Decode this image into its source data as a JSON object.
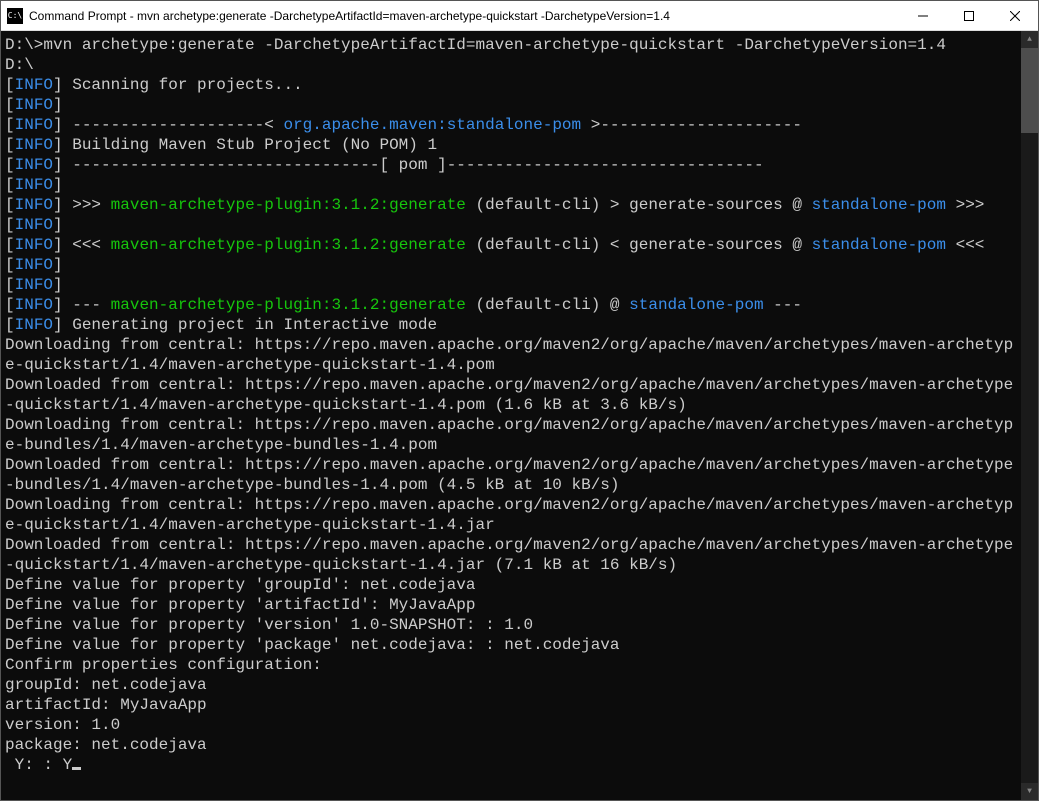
{
  "window": {
    "title": "Command Prompt - mvn  archetype:generate -DarchetypeArtifactId=maven-archetype-quickstart -DarchetypeVersion=1.4",
    "icon_label": "C:\\"
  },
  "terminal": {
    "cmd_prompt": "D:\\>",
    "cmd_line": "mvn archetype:generate -DarchetypeArtifactId=maven-archetype-quickstart -DarchetypeVersion=1.4",
    "cwd": "D:\\",
    "info_label": "INFO",
    "scan_msg": " Scanning for projects...",
    "bar_open_artifact": " --------------------< ",
    "artifact_coord": "org.apache.maven:standalone-pom",
    "bar_close_artifact": " >---------------------",
    "building_msg": " Building Maven Stub Project (No POM) 1",
    "bar_pom": " --------------------------------[ pom ]---------------------------------",
    "arrows_in": " >>> ",
    "arrows_out": " <<< ",
    "dashes3": " --- ",
    "plugin_goal": "maven-archetype-plugin:3.1.2:generate",
    "default_cli_gt": " (default-cli) > generate-sources @ ",
    "default_cli_lt": " (default-cli) < generate-sources @ ",
    "default_cli_at": " (default-cli) @ ",
    "standalone": "standalone-pom",
    "arrows_in_end": " >>>",
    "arrows_out_end": " <<<",
    "dashes3_end": " ---",
    "gen_interactive": " Generating project in Interactive mode",
    "dl_lines": [
      "Downloading from central: https://repo.maven.apache.org/maven2/org/apache/maven/archetypes/maven-archetype-quickstart/1.4/maven-archetype-quickstart-1.4.pom",
      "Downloaded from central: https://repo.maven.apache.org/maven2/org/apache/maven/archetypes/maven-archetype-quickstart/1.4/maven-archetype-quickstart-1.4.pom (1.6 kB at 3.6 kB/s)",
      "Downloading from central: https://repo.maven.apache.org/maven2/org/apache/maven/archetypes/maven-archetype-bundles/1.4/maven-archetype-bundles-1.4.pom",
      "Downloaded from central: https://repo.maven.apache.org/maven2/org/apache/maven/archetypes/maven-archetype-bundles/1.4/maven-archetype-bundles-1.4.pom (4.5 kB at 10 kB/s)",
      "Downloading from central: https://repo.maven.apache.org/maven2/org/apache/maven/archetypes/maven-archetype-quickstart/1.4/maven-archetype-quickstart-1.4.jar",
      "Downloaded from central: https://repo.maven.apache.org/maven2/org/apache/maven/archetypes/maven-archetype-quickstart/1.4/maven-archetype-quickstart-1.4.jar (7.1 kB at 16 kB/s)"
    ],
    "props": [
      "Define value for property 'groupId': net.codejava",
      "Define value for property 'artifactId': MyJavaApp",
      "Define value for property 'version' 1.0-SNAPSHOT: : 1.0",
      "Define value for property 'package' net.codejava: : net.codejava",
      "Confirm properties configuration:",
      "groupId: net.codejava",
      "artifactId: MyJavaApp",
      "version: 1.0",
      "package: net.codejava"
    ],
    "confirm_prompt": " Y: : Y"
  }
}
